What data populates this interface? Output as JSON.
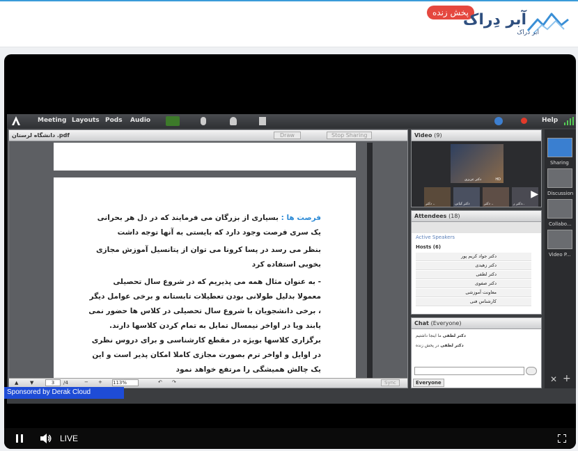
{
  "header": {
    "logo_title": "آبر دِراک",
    "logo_sub": "ابر دراک",
    "live_badge": "پخش زنده"
  },
  "connect": {
    "menu": [
      "Meeting",
      "Layouts",
      "Pods",
      "Audio"
    ],
    "help": "Help",
    "share_pod": {
      "filename": "دانشگاه لرستان .pdf",
      "draw": "Draw",
      "stop_sharing": "Stop Sharing",
      "page_current": "3",
      "page_total": "/4",
      "zoom": "113%",
      "sync": "Sync"
    },
    "document": {
      "p1_lead": "فرصت ها :",
      "p1_rest": " بسیاری از بزرگان می فرمایند که در دل هر بحرانی یک سری فرصت وجود دارد که بایستی به آنها توجه داشت",
      "p2": "بنظر می رسد در پسا کرونا می توان از پتانسیل آموزش مجازی بخوبی استفاده کرد",
      "p3": "- به عنوان مثال همه می پذیریم که در شروع سال تحصیلی معمولا بدلیل طولانی بودن تعطیلات تابستانه و برخی عوامل دیگر ، برخی دانشجویان با شروع سال تحصیلی در کلاس ها حضور نمی یابند ویا در اواخر نیمسال تمایل به تمام کردن کلاسها دارند. برگزاری کلاسها بویژه در مقطع کارشناسی و برای دروس نظری در اوایل و اواخر ترم بصورت مجازی کاملا امکان پذیر است و این یک چالش همیشگی را مرتفع خواهد نمود"
    },
    "video_pod": {
      "title": "Video",
      "count": "(9)",
      "main_label": "دکتر عزیزی",
      "hd": "HD",
      "thumbs": [
        "دکتر ..",
        "دکتر کیانی",
        "دکتر ..",
        "دکتر ر..",
        "دکتر .."
      ]
    },
    "attendees_pod": {
      "title": "Attendees",
      "count": "(18)",
      "active_speakers": "Active Speakers",
      "hosts": "Hosts (6)",
      "names": [
        "دکتر جواد کریم پور",
        "دکتر زهیدی",
        "دکتر لطفی",
        "دکتر صفوی",
        "معاونت آموزشی",
        "کارشناس فنی"
      ]
    },
    "chat_pod": {
      "title": "Chat",
      "scope": "(Everyone)",
      "messages": [
        {
          "sender": "دکتر لطفی",
          "text": "ما اینجا داشتیم"
        },
        {
          "sender": "دکتر لطفی",
          "text": "در پخش زنده"
        }
      ],
      "tab": "Everyone"
    },
    "right_panel": [
      "Sharing",
      "Discussion",
      "Collabo...",
      "Video P..."
    ]
  },
  "player": {
    "live_label": "LIVE",
    "sponsor": "Sponsored by Derak Cloud"
  }
}
